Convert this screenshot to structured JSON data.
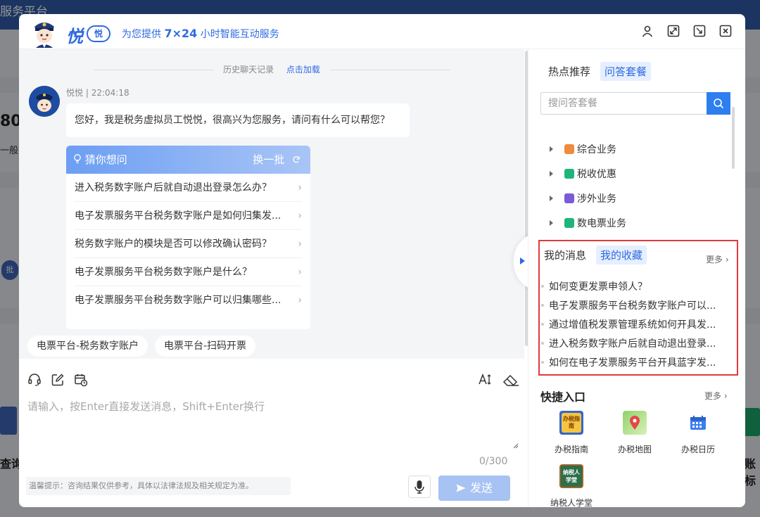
{
  "background": {
    "topbar_title": "服务平台",
    "big_number": "80",
    "side_text": "一般",
    "pill_text": "批",
    "left_label": "查询",
    "right_label": "账标"
  },
  "header": {
    "brand_char": "悦",
    "brand_badge": "悦",
    "slogan_prefix": "为您提供",
    "slogan_strong": "7×24",
    "slogan_suffix": "小时智能互动服务",
    "icons": [
      "user-icon",
      "fullscreen-icon",
      "minimize-icon",
      "close-icon"
    ]
  },
  "chat": {
    "history_label": "历史聊天记录",
    "load_label": "点击加载",
    "message": {
      "sender": "悦悦",
      "time": "22:04:18",
      "text": "您好，我是税务虚拟员工悦悦，很高兴为您服务，请问有什么可以帮您？"
    },
    "guess": {
      "title": "猜你想问",
      "refresh_label": "换一批",
      "items": [
        "进入税务数字账户后就自动退出登录怎么办？",
        "电子发票服务平台税务数字账户是如何归集发...",
        "税务数字账户的模块是否可以修改确认密码？",
        "电子发票服务平台税务数字账户是什么？",
        "电子发票服务平台税务数字账户可以归集哪些..."
      ]
    },
    "quick_tags": [
      "电票平台-税务数字账户",
      "电票平台-扫码开票"
    ]
  },
  "input": {
    "placeholder": "请输入，按Enter直接发送消息，Shift+Enter换行",
    "counter": "0/300",
    "tip": "温馨提示：咨询结果仅供参考，具体以法律法规及相关规定为准。",
    "send_label": "发送"
  },
  "right_panel": {
    "tabs": [
      "热点推荐",
      "问答套餐"
    ],
    "active_tab": "问答套餐",
    "search_placeholder": "搜问答套餐",
    "categories": [
      {
        "label": "综合业务",
        "color": "#f08a3c"
      },
      {
        "label": "税收优惠",
        "color": "#1fb57a"
      },
      {
        "label": "涉外业务",
        "color": "#7a5bd8"
      },
      {
        "label": "数电票业务",
        "color": "#1fb57a"
      }
    ],
    "favorites": {
      "tabs": [
        "我的消息",
        "我的收藏"
      ],
      "active_tab": "我的收藏",
      "more_label": "更多",
      "items": [
        "如何变更发票申领人？",
        "电子发票服务平台税务数字账户可以...",
        "通过增值税发票管理系统如何开具发...",
        "进入税务数字账户后就自动退出登录...",
        "如何在电子发票服务平台开具蓝字发..."
      ]
    },
    "quick_entry": {
      "title": "快捷入口",
      "more_label": "更多",
      "items": [
        {
          "label": "办税指南",
          "icon": "tax-guide-icon",
          "icon_text": "办税指南"
        },
        {
          "label": "办税地图",
          "icon": "map-pin-icon"
        },
        {
          "label": "办税日历",
          "icon": "calendar-icon"
        },
        {
          "label": "纳税人学堂",
          "icon": "classroom-icon",
          "icon_text": "纳税人学堂"
        }
      ]
    }
  }
}
